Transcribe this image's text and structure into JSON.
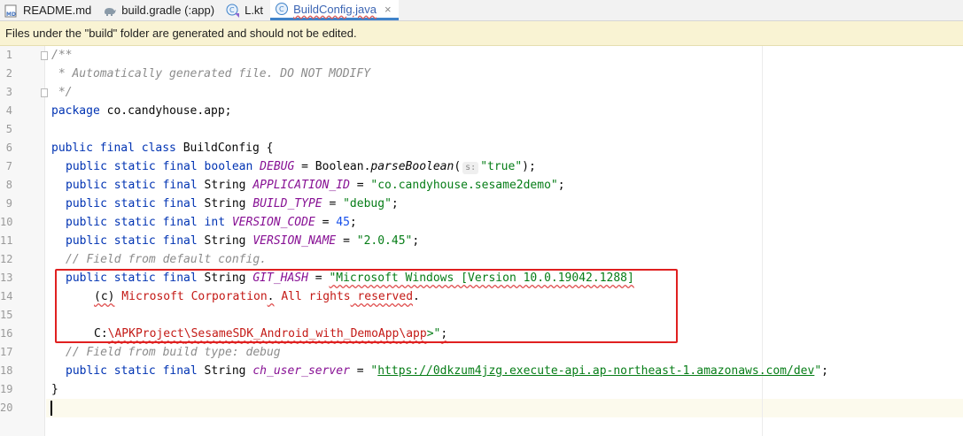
{
  "tabs": [
    {
      "label": "README.md",
      "icon": "markdown-file-icon",
      "active": false
    },
    {
      "label": "build.gradle (:app)",
      "icon": "gradle-elephant-icon",
      "active": false
    },
    {
      "label": "L.kt",
      "icon": "kotlin-class-icon",
      "active": false
    },
    {
      "label": "BuildConfig.java",
      "icon": "java-class-icon",
      "active": true
    }
  ],
  "close_glyph": "×",
  "notification": "Files under the \"build\" folder are generated and should not be edited.",
  "colors": {
    "keyword": "#0033b3",
    "comment": "#8c8c8c",
    "constant": "#871094",
    "string": "#067d17",
    "number": "#1750eb",
    "highlight_box": "#e02020"
  },
  "editor": {
    "line_numbers": [
      "1",
      "2",
      "3",
      "4",
      "5",
      "6",
      "7",
      "8",
      "9",
      "10",
      "11",
      "12",
      "13",
      "14",
      "15",
      "16",
      "17",
      "18",
      "19",
      "20"
    ],
    "code": {
      "l1": "/**",
      "l2": " * Automatically generated file. DO NOT MODIFY",
      "l3": " */",
      "l4_kw": "package",
      "l4_rest": " co.candyhouse.app;",
      "l6_kw": "public final class",
      "l6_rest": " BuildConfig {",
      "mods": "public static final",
      "t_boolean": "boolean",
      "t_string": "String",
      "t_int": "int",
      "c_debug": "DEBUG",
      "l7_mid": " = Boolean.",
      "l7_method": "parseBoolean",
      "l7_open": "(",
      "l7_hint": "s:",
      "l7_str": "\"true\"",
      "l7_end": ");",
      "c_app_id": "APPLICATION_ID",
      "l8_str": "\"co.candyhouse.sesame2demo\"",
      "c_build_type": "BUILD_TYPE",
      "l10_str": "\"debug\"",
      "c_version_code": "VERSION_CODE",
      "l10_num": "45",
      "c_version_name": "VERSION_NAME",
      "l11_str": "\"2.0.45\"",
      "eq": " = ",
      "semi": ";",
      "l12": "// Field from default config.",
      "c_git_hash": "GIT_HASH",
      "l13_str": "\"Microsoft Windows [Version 10.0.19042.1288]",
      "l14_a": "(c)",
      "l14_b": " Microsoft Corporation",
      "l14_c": ".",
      "l14_d": " All rights",
      "l14_e": " reserved",
      "l14_f": ".",
      "l16_a": "C:",
      "l16_b": "\\APKProject",
      "l16_c": "\\SesameSDK_Android_with_DemoApp",
      "l16_d": "\\app",
      "l16_e": ">\"",
      "l16_f": ";",
      "l17": "// Field from build type: debug",
      "ch_user_server": "ch_user_server",
      "l18_str_q1": "\"",
      "l18_url": "https://0dkzum4jzg.execute-api.ap-northeast-1.amazonaws.com/dev",
      "l18_str_q2": "\"",
      "l19": "}"
    }
  }
}
